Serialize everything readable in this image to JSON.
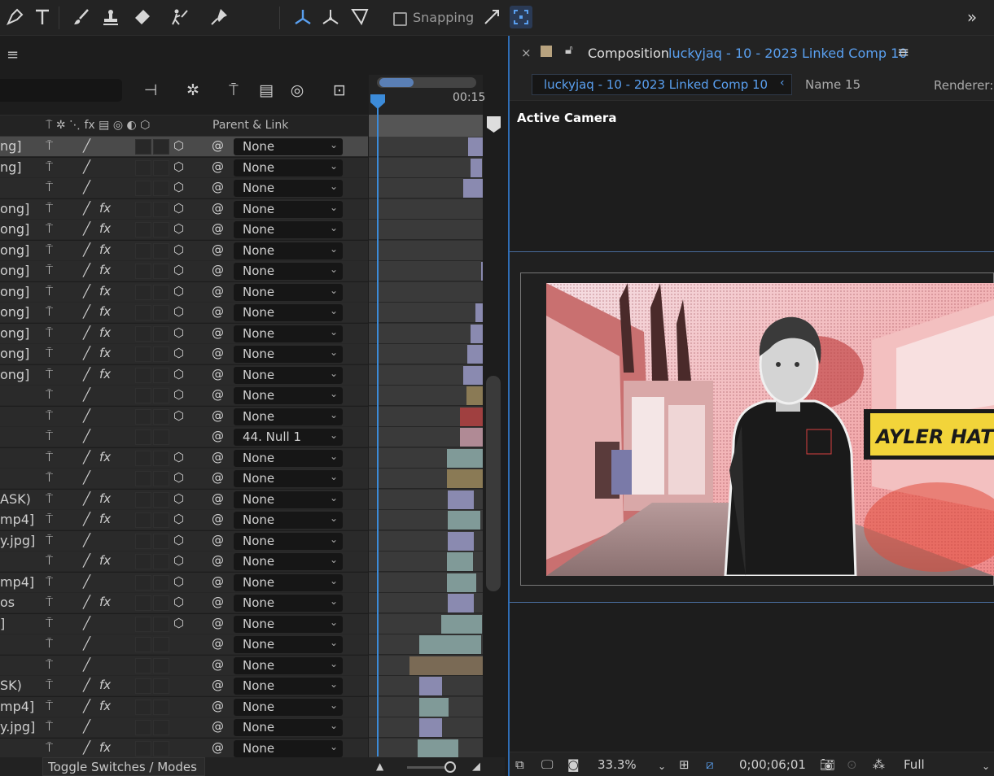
{
  "toolbar": {
    "snapping_label": "Snapping",
    "tools": [
      "pen-tool",
      "type-tool",
      "brush-tool",
      "clone-stamp-tool",
      "eraser-tool",
      "roto-brush-tool",
      "puppet-pin-tool",
      "local-axis-mode",
      "world-axis-mode",
      "view-axis-mode",
      "snap-icon",
      "grid-snap-icon",
      "expand-icon"
    ]
  },
  "timeline": {
    "menu_icon": "≡",
    "column_header": {
      "parent_link": "Parent & Link"
    },
    "time_label": "00:15",
    "toggle_label": "Toggle Switches / Modes",
    "layers": [
      {
        "name": "ng]",
        "fx": false,
        "cube": true,
        "parent": "None"
      },
      {
        "name": "ng]",
        "fx": false,
        "cube": true,
        "parent": "None"
      },
      {
        "name": "",
        "fx": false,
        "cube": true,
        "parent": "None"
      },
      {
        "name": "ong]",
        "fx": true,
        "cube": true,
        "parent": "None"
      },
      {
        "name": "ong]",
        "fx": true,
        "cube": true,
        "parent": "None"
      },
      {
        "name": "ong]",
        "fx": true,
        "cube": true,
        "parent": "None"
      },
      {
        "name": "ong]",
        "fx": true,
        "cube": true,
        "parent": "None"
      },
      {
        "name": "ong]",
        "fx": true,
        "cube": true,
        "parent": "None"
      },
      {
        "name": "ong]",
        "fx": true,
        "cube": true,
        "parent": "None"
      },
      {
        "name": "ong]",
        "fx": true,
        "cube": true,
        "parent": "None"
      },
      {
        "name": "ong]",
        "fx": true,
        "cube": true,
        "parent": "None"
      },
      {
        "name": "ong]",
        "fx": true,
        "cube": true,
        "parent": "None"
      },
      {
        "name": "",
        "fx": false,
        "cube": true,
        "parent": "None"
      },
      {
        "name": "",
        "fx": false,
        "cube": true,
        "parent": "None"
      },
      {
        "name": "",
        "fx": false,
        "cube": false,
        "parent": "44. Null 1"
      },
      {
        "name": "",
        "fx": true,
        "cube": true,
        "parent": "None"
      },
      {
        "name": "",
        "fx": false,
        "cube": true,
        "parent": "None"
      },
      {
        "name": "ASK)",
        "fx": true,
        "cube": true,
        "parent": "None"
      },
      {
        "name": "mp4]",
        "fx": true,
        "cube": true,
        "parent": "None"
      },
      {
        "name": "y.jpg]",
        "fx": false,
        "cube": true,
        "parent": "None"
      },
      {
        "name": "",
        "fx": true,
        "cube": true,
        "parent": "None"
      },
      {
        "name": "mp4]",
        "fx": false,
        "cube": true,
        "parent": "None"
      },
      {
        "name": "os",
        "fx": true,
        "cube": true,
        "parent": "None"
      },
      {
        "name": "]",
        "fx": false,
        "cube": true,
        "parent": "None"
      },
      {
        "name": "",
        "fx": false,
        "cube": false,
        "parent": "None"
      },
      {
        "name": "",
        "fx": false,
        "cube": false,
        "parent": "None"
      },
      {
        "name": "SK)",
        "fx": true,
        "cube": false,
        "parent": "None"
      },
      {
        "name": "mp4]",
        "fx": true,
        "cube": false,
        "parent": "None"
      },
      {
        "name": "y.jpg]",
        "fx": false,
        "cube": false,
        "parent": "None"
      },
      {
        "name": "",
        "fx": true,
        "cube": false,
        "parent": "None"
      }
    ]
  },
  "composition": {
    "panel_label": "Composition",
    "comp_name": "luckyjaq - 10 - 2023 Linked Comp 10",
    "tab_label": "luckyjaq - 10 - 2023 Linked Comp 10",
    "name_label": "Name 15",
    "renderer_label": "Renderer:",
    "active_camera": "Active Camera",
    "lower_third_text": "AYLER HATHW",
    "zoom": "33.3%",
    "timecode": "0;00;06;01",
    "resolution": "Full"
  },
  "colors": {
    "accent": "#3c8bd9",
    "link_blue": "#5aa0f0",
    "lower_third_yellow": "#f2d43a"
  }
}
